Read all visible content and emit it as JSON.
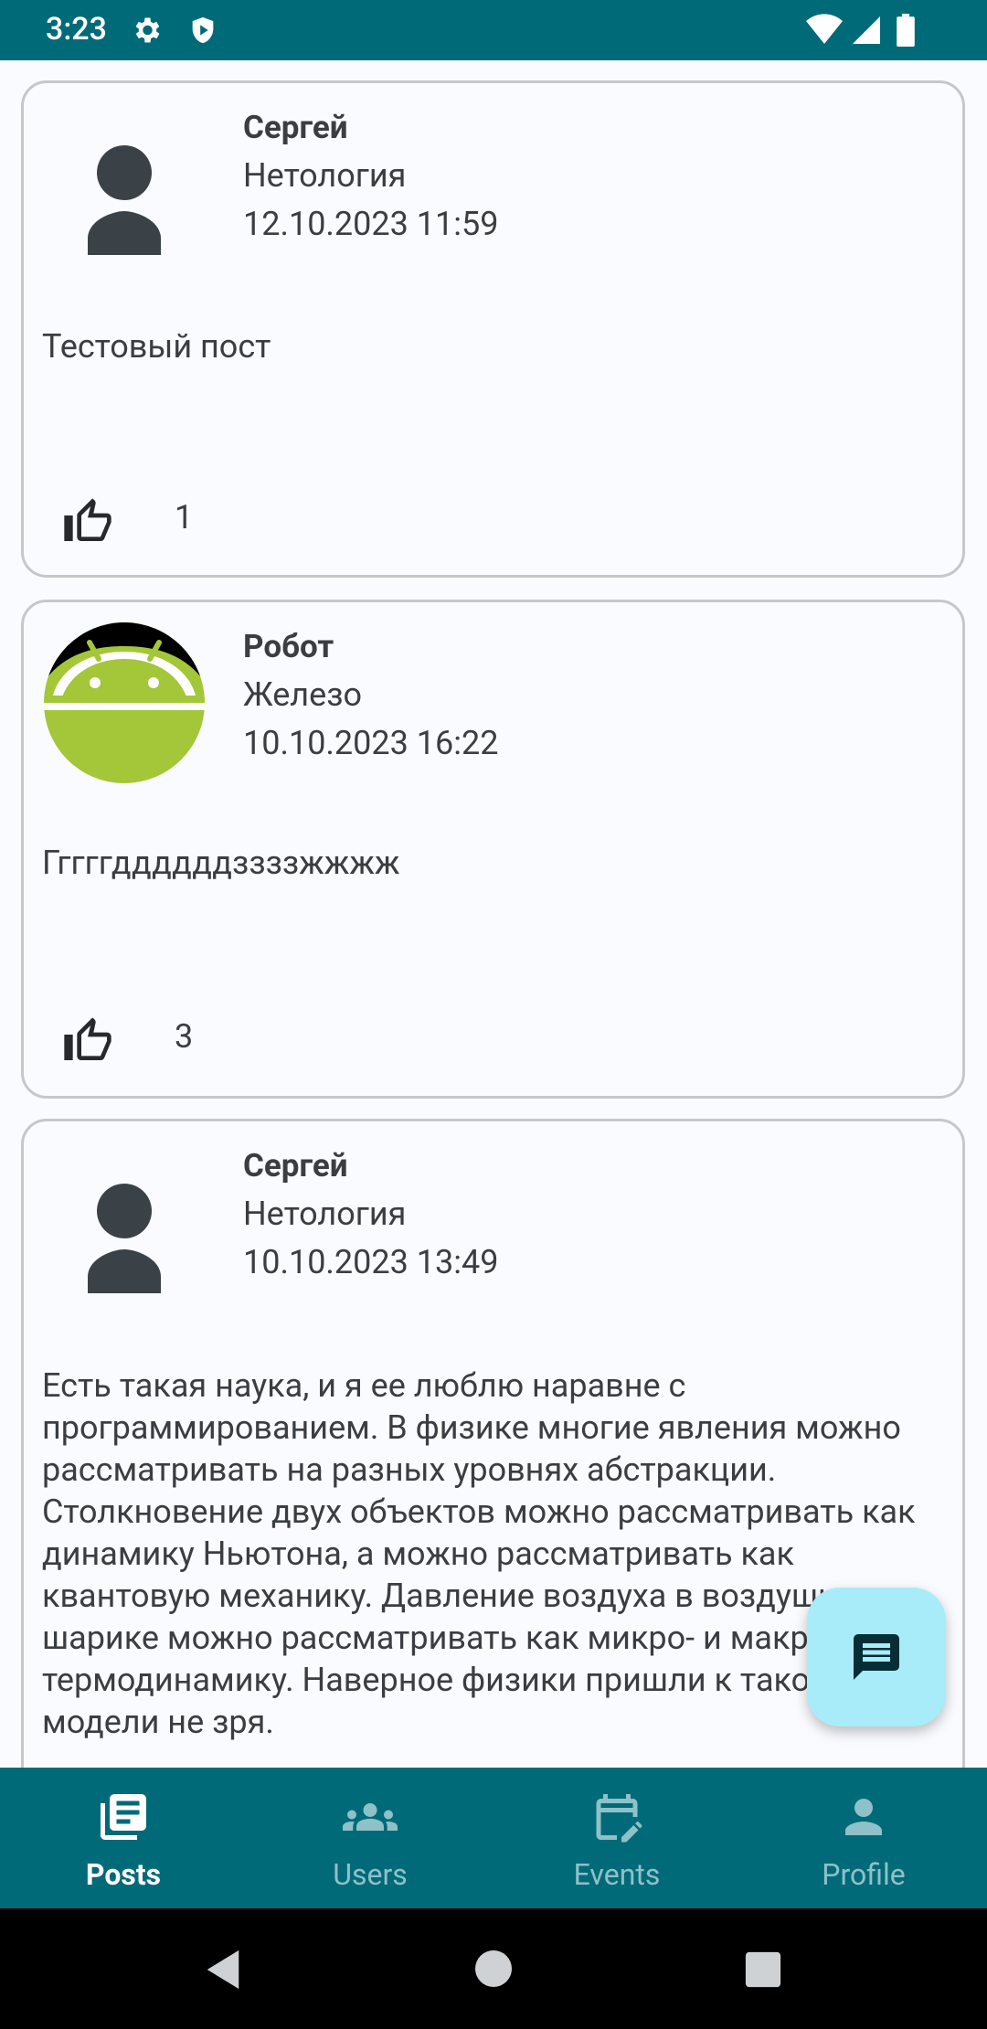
{
  "status_bar": {
    "time": "3:23"
  },
  "posts": [
    {
      "author": "Сергей",
      "job": "Нетология",
      "published": "12.10.2023 11:59",
      "content": "Тестовый пост",
      "likes": "1",
      "avatar": "default-person"
    },
    {
      "author": "Робот",
      "job": "Железо",
      "published": "10.10.2023 16:22",
      "content": "Гггггддддддззззжжжж",
      "likes": "3",
      "avatar": "android-robot"
    },
    {
      "author": "Сергей",
      "job": "Нетология",
      "published": "10.10.2023 13:49",
      "content": "Есть такая наука, и я ее люблю наравне с программированием. В физике многие явления можно рассматривать на разных уровнях абстракции. Столкновение двух объектов можно рассматривать как динамику Ньютона, а можно рассматривать как квантовую механику. Давление воздуха в воздушном шарике можно рассматривать как микро- и макро-термодинамику. Наверное физики пришли к такой модели не зря.",
      "avatar": "default-person"
    }
  ],
  "bottom_nav": {
    "items": [
      {
        "label": "Posts",
        "icon": "posts-icon",
        "active": true
      },
      {
        "label": "Users",
        "icon": "users-icon",
        "active": false
      },
      {
        "label": "Events",
        "icon": "events-icon",
        "active": false
      },
      {
        "label": "Profile",
        "icon": "profile-icon",
        "active": false
      }
    ]
  },
  "colors": {
    "primary": "#006a78",
    "fab": "#a8ecfa",
    "background": "#fafbfe",
    "card_border": "#c5c7cb"
  }
}
